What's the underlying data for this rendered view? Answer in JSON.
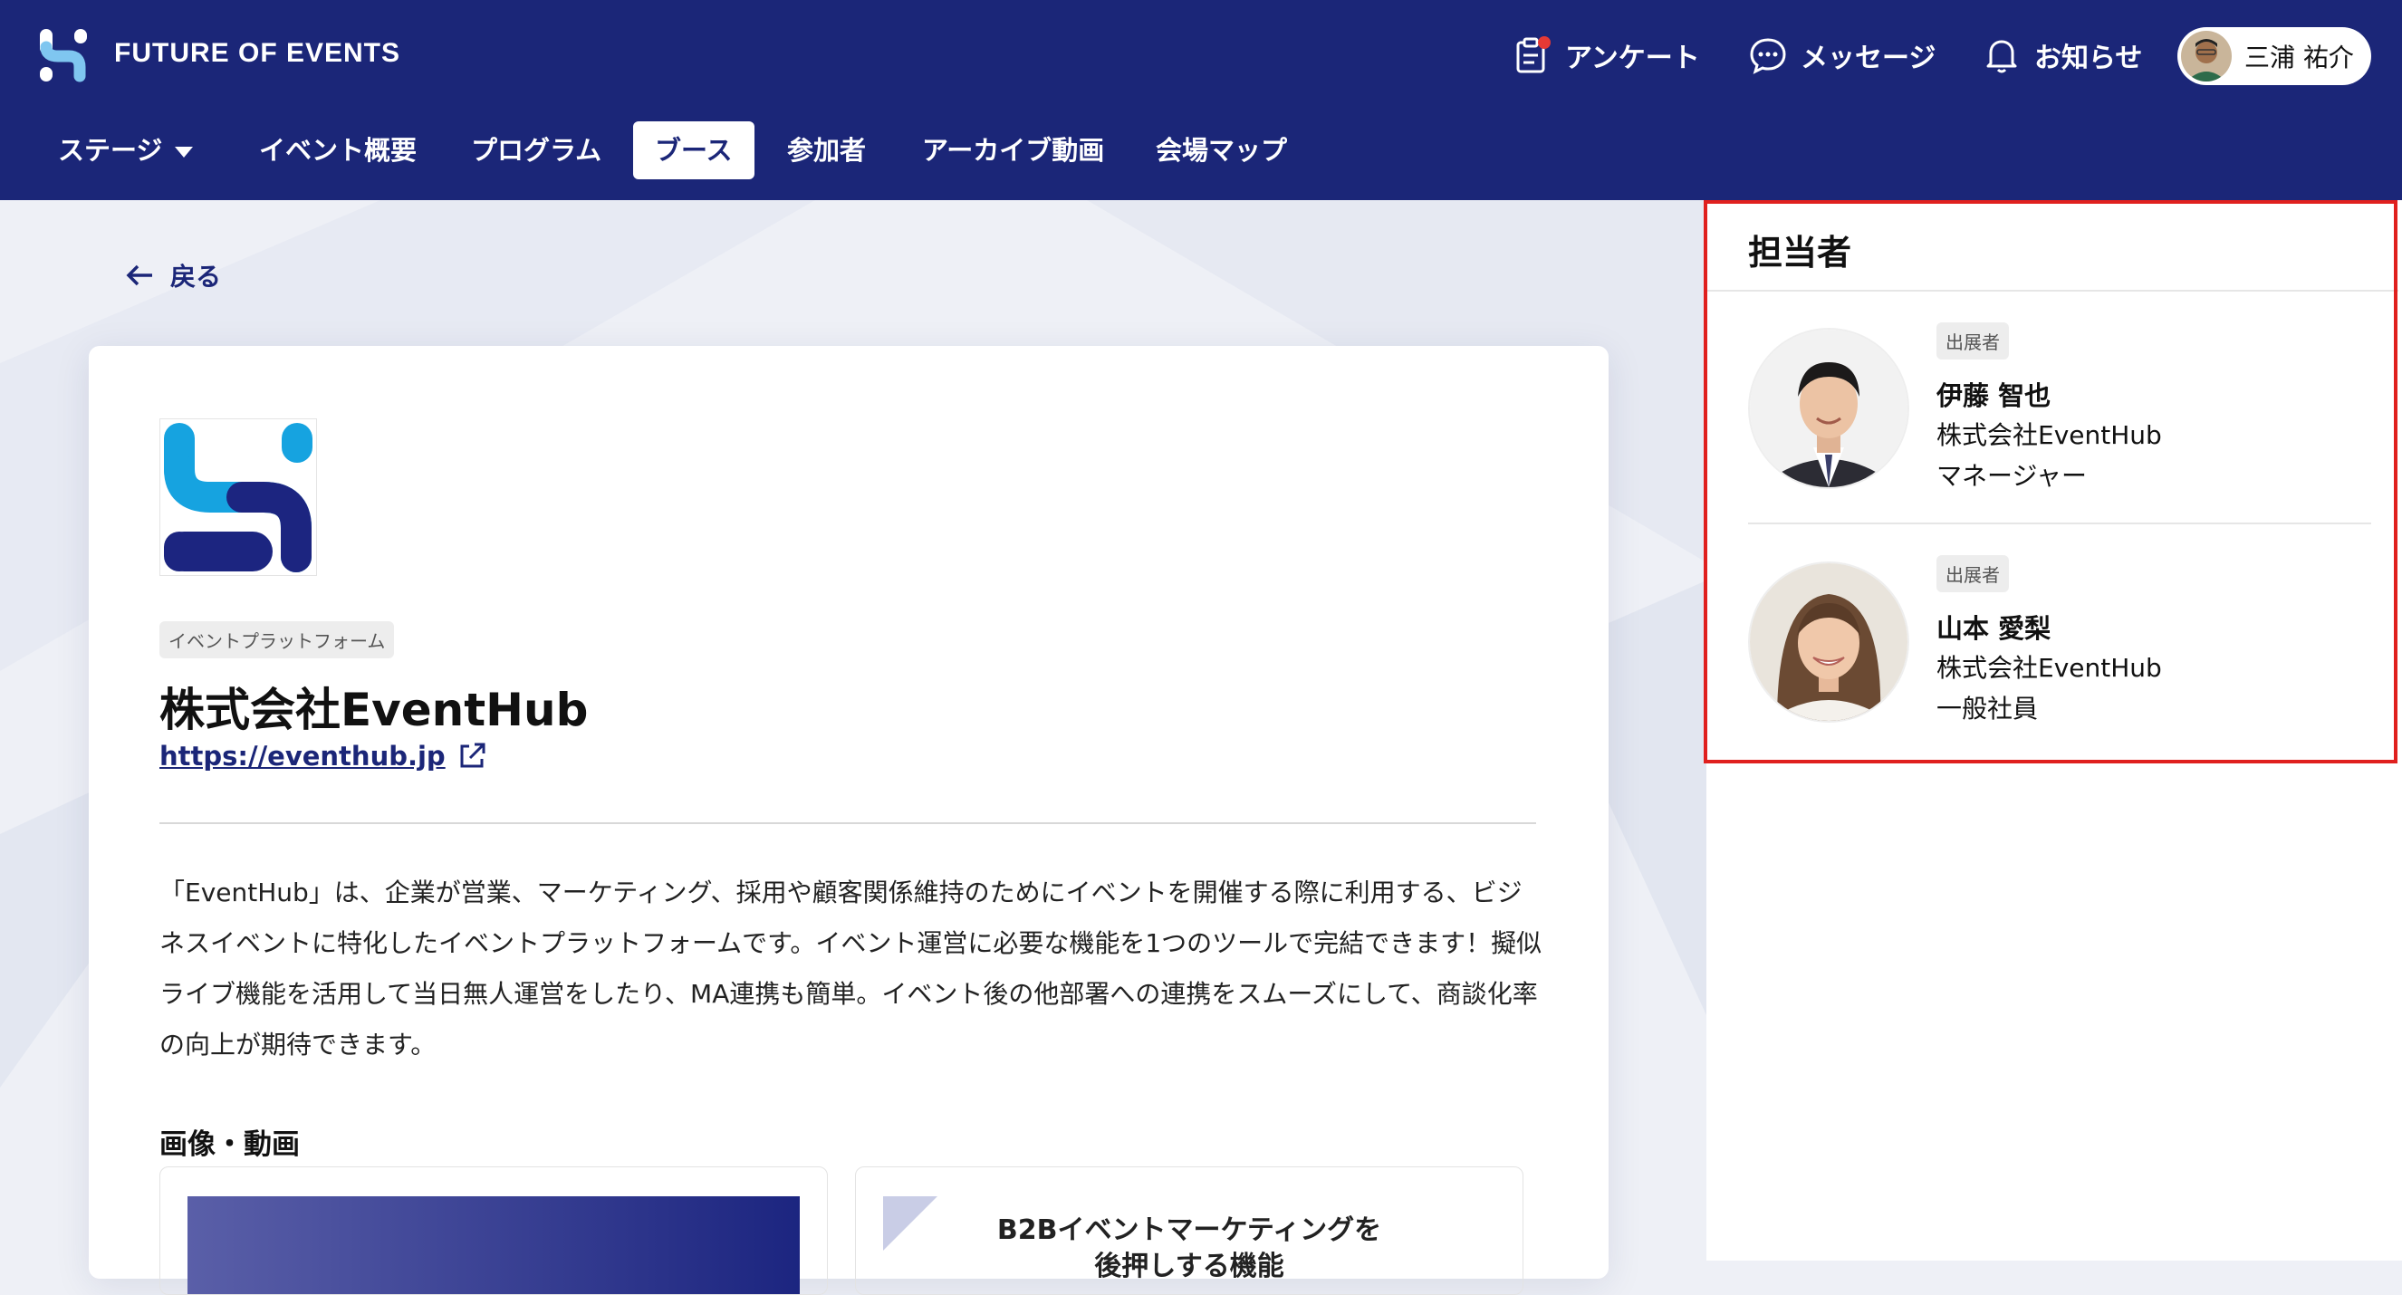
{
  "header": {
    "brand": "FUTURE OF EVENTS",
    "actions": {
      "survey": "アンケート",
      "messages": "メッセージ",
      "notifications": "お知らせ"
    },
    "user_name": "三浦 祐介"
  },
  "nav": {
    "stage": "ステージ",
    "overview": "イベント概要",
    "program": "プログラム",
    "booth": "ブース",
    "participants": "参加者",
    "archive": "アーカイブ動画",
    "venue_map": "会場マップ"
  },
  "back_label": "戻る",
  "company": {
    "category": "イベントプラットフォーム",
    "name": "株式会社EventHub",
    "url": "https://eventhub.jp",
    "description": "「EventHub」は、企業が営業、マーケティング、採用や顧客関係維持のためにイベントを開催する際に利用する、ビジネスイベントに特化したイベントプラットフォームです。イベント運営に必要な機能を1つのツールで完結できます！擬似ライブ機能を活用して当日無人運営をしたり、MA連携も簡単。イベント後の他部署への連携をスムーズにして、商談化率の向上が期待できます。"
  },
  "media": {
    "section_title": "画像・動画",
    "item2_title": "B2Bイベントマーケティングを",
    "item2_title_line2": "後押しする機能"
  },
  "contacts": {
    "title": "担当者",
    "members": [
      {
        "badge": "出展者",
        "name": "伊藤 智也",
        "company": "株式会社EventHub",
        "role": "マネージャー"
      },
      {
        "badge": "出展者",
        "name": "山本 愛梨",
        "company": "株式会社EventHub",
        "role": "一般社員"
      }
    ]
  },
  "colors": {
    "header_bg": "#1b2678",
    "logo_light": "#16a3e0",
    "logo_dark": "#1c2580",
    "highlight": "#e0201e",
    "notification_dot": "#e53935"
  }
}
